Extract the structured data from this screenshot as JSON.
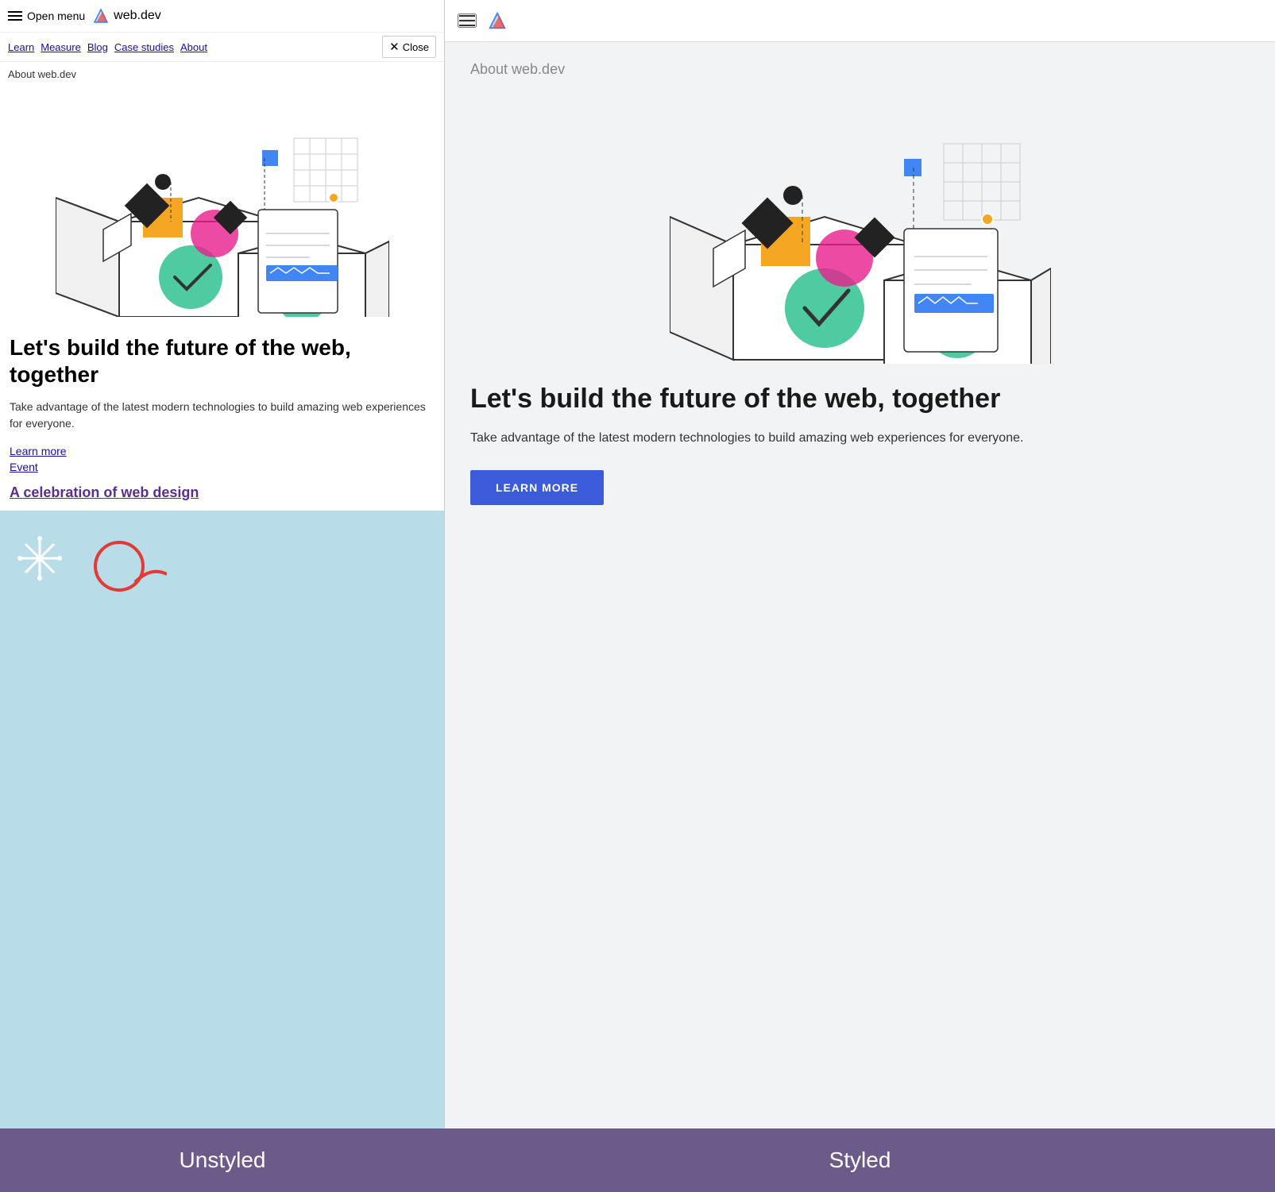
{
  "left": {
    "header": {
      "menu_label": "Open menu",
      "logo_text": "web.dev",
      "close_label": "Close"
    },
    "nav": {
      "links": [
        "Learn",
        "Measure",
        "Blog",
        "Case studies",
        "About"
      ]
    },
    "about_label": "About web.dev",
    "heading": "Let's build the future of the web, together",
    "description": "Take advantage of the latest modern technologies to build amazing web experiences for everyone.",
    "links": [
      {
        "label": "Learn more",
        "href": "#"
      },
      {
        "label": "Event",
        "href": "#"
      }
    ],
    "event_link": "A celebration of web design",
    "label": "Unstyled"
  },
  "right": {
    "about_label": "About web.dev",
    "heading": "Let's build the future of the web, together",
    "description": "Take advantage of the latest modern technologies to build amazing web experiences for everyone.",
    "learn_more_btn": "LEARN MORE",
    "label": "Styled"
  }
}
